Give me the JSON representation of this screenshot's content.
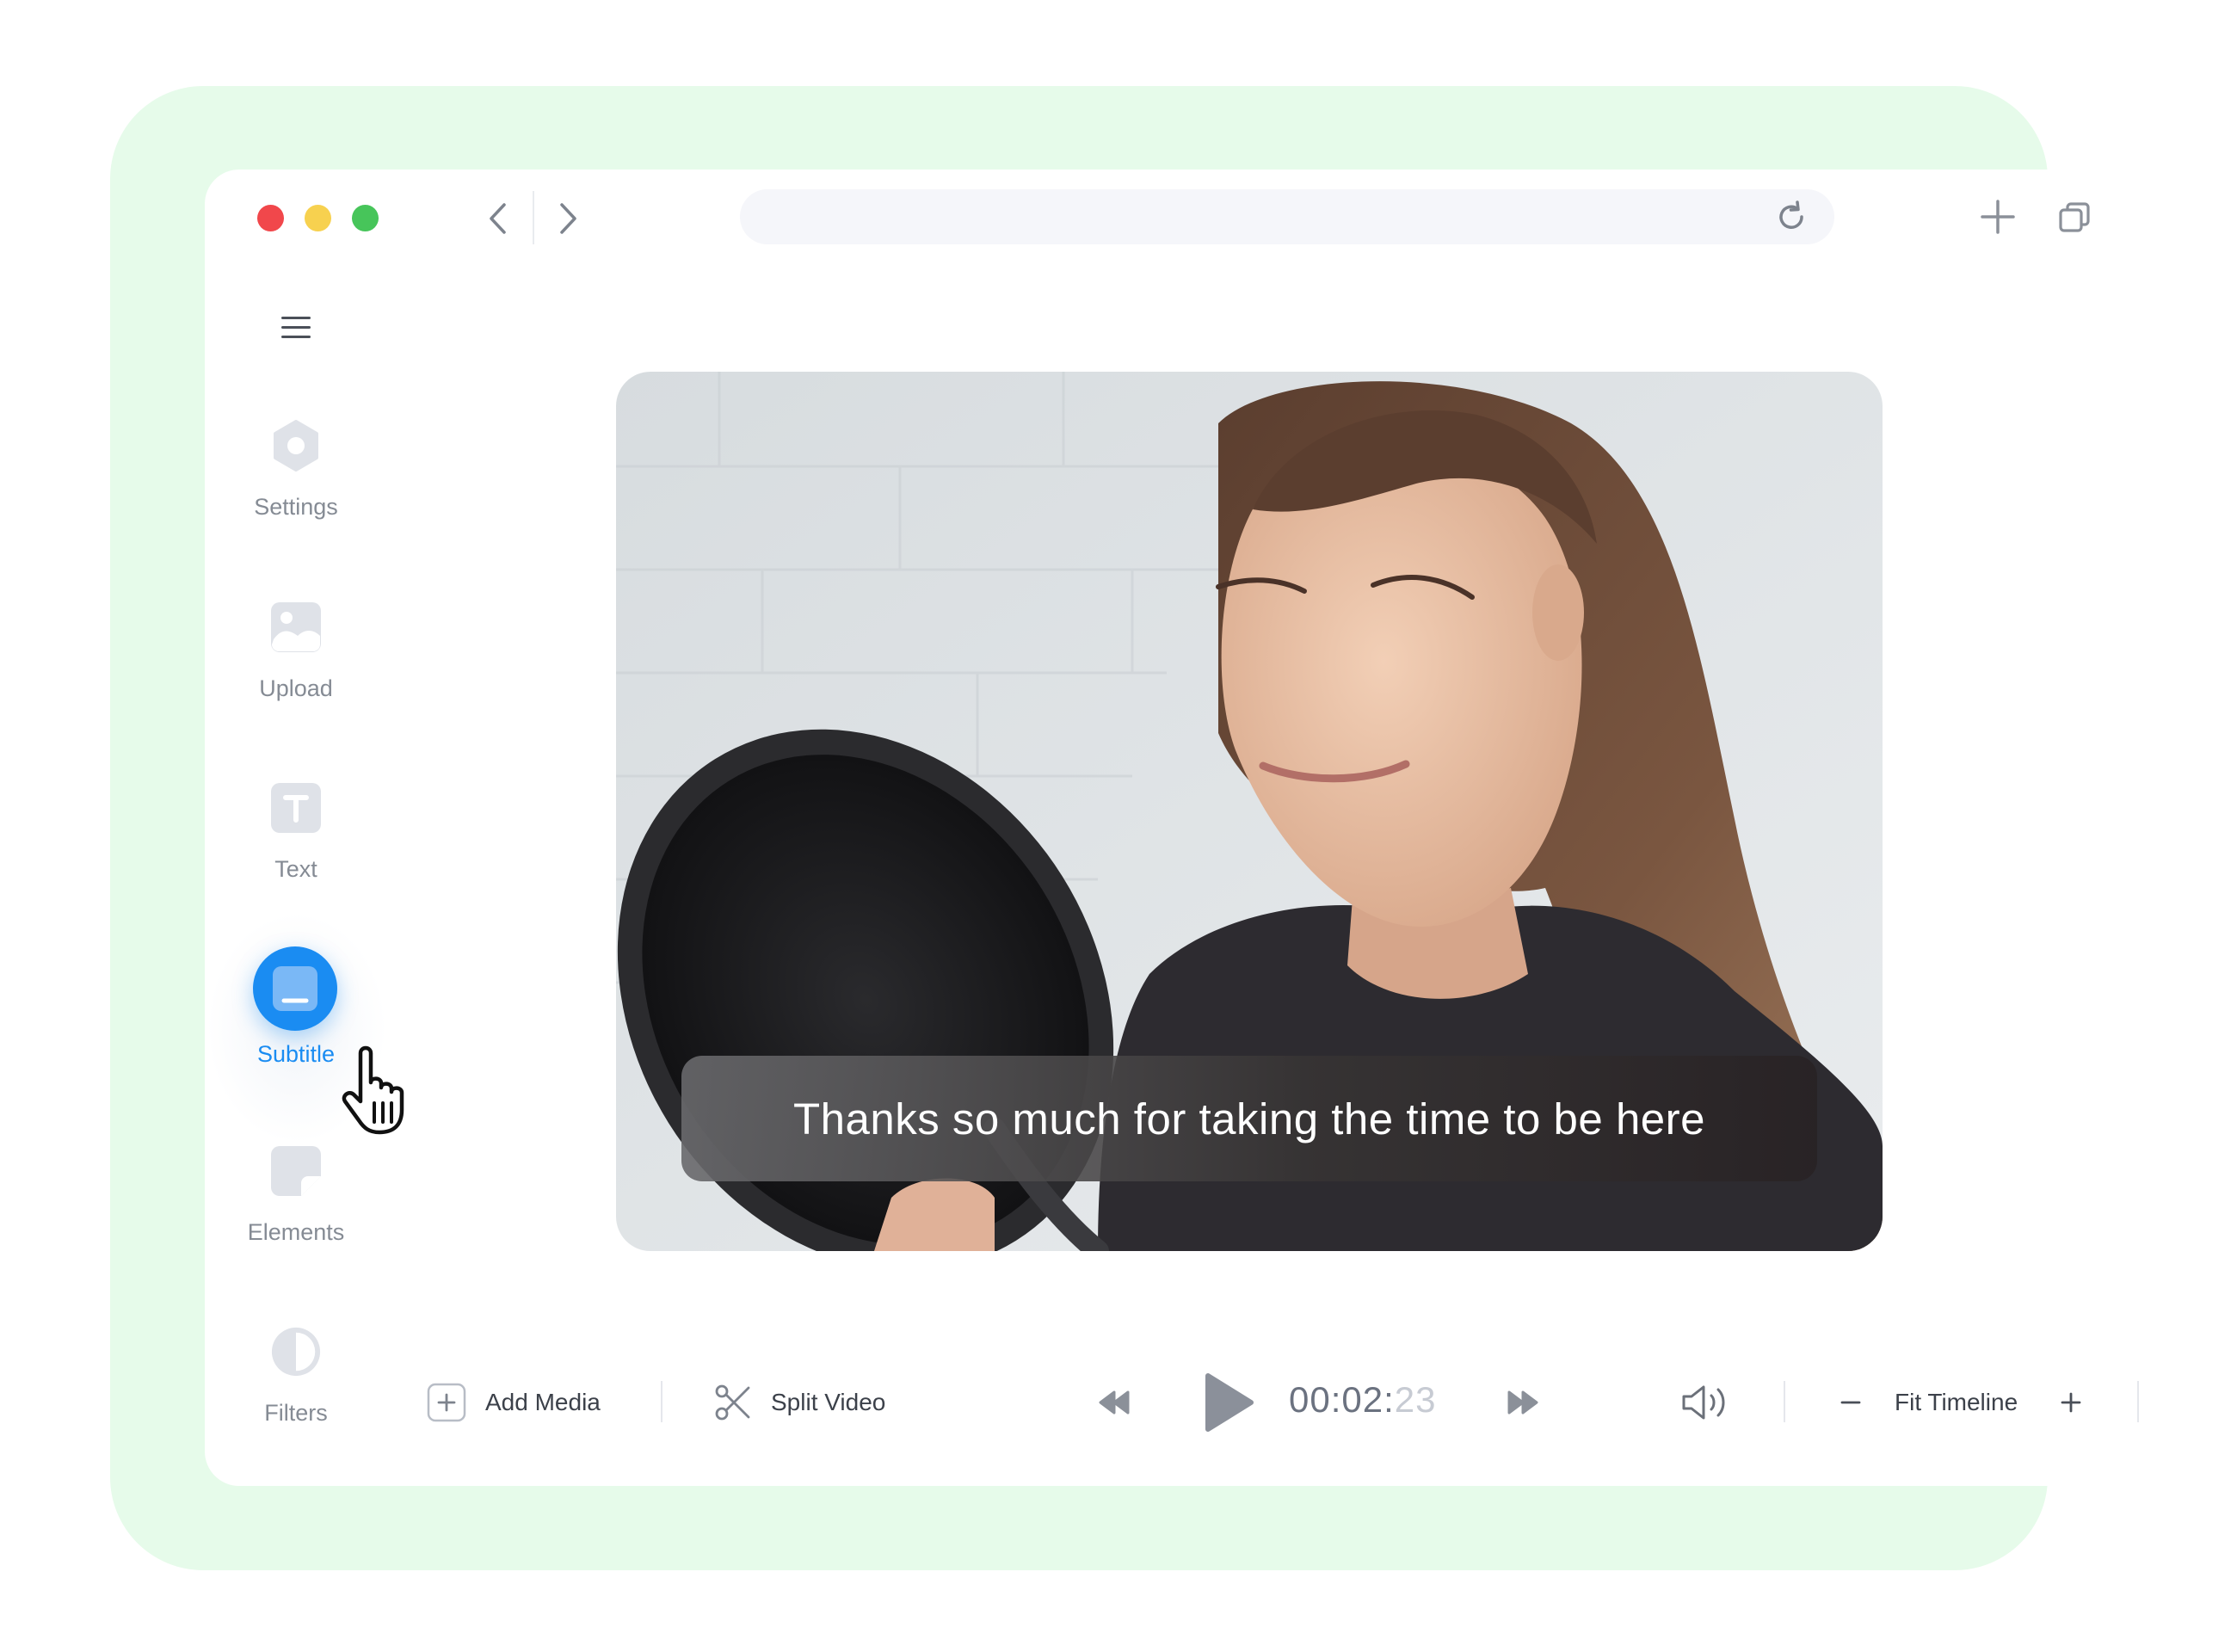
{
  "browser": {
    "traffic_lights": [
      "close",
      "minimize",
      "maximize"
    ],
    "colors": {
      "close": "#f1474b",
      "minimize": "#f7d14f",
      "maximize": "#47c55a"
    },
    "address": ""
  },
  "sidebar": {
    "items": [
      {
        "label": "Settings",
        "icon": "settings-icon"
      },
      {
        "label": "Upload",
        "icon": "image-icon"
      },
      {
        "label": "Text",
        "icon": "text-icon"
      },
      {
        "label": "Subtitle",
        "icon": "subtitle-icon",
        "active": true
      },
      {
        "label": "Elements",
        "icon": "sticker-icon"
      },
      {
        "label": "Filters",
        "icon": "contrast-icon"
      }
    ],
    "active_color": "#1a8cf2"
  },
  "video": {
    "subtitle": "Thanks so much for taking the time to be here"
  },
  "toolbar": {
    "add_media": "Add Media",
    "split_video": "Split Video",
    "time_main": "00:02:",
    "time_frames": "23",
    "fit_timeline": "Fit Timeline"
  }
}
